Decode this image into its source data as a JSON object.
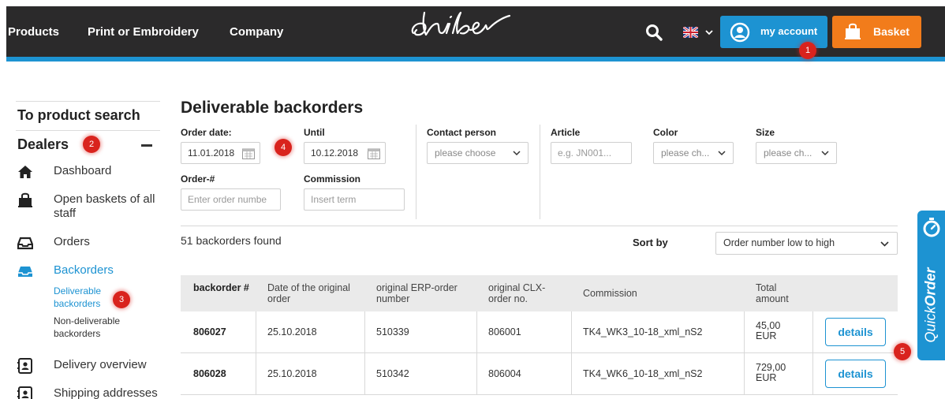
{
  "nav": {
    "links": [
      "Products",
      "Print or Embroidery",
      "Company"
    ],
    "logo_text": "daiber",
    "account_label": "my account",
    "basket_label": "Basket",
    "flag_icon": "uk-flag-icon"
  },
  "markers": [
    "1",
    "2",
    "3",
    "4",
    "5"
  ],
  "sidebar": {
    "product_search": "To product search",
    "section_title": "Dealers",
    "items": [
      {
        "label": "Dashboard",
        "icon": "home-icon"
      },
      {
        "label": "Open baskets of all staff",
        "icon": "basket-icon"
      },
      {
        "label": "Orders",
        "icon": "inbox-icon"
      },
      {
        "label": "Backorders",
        "icon": "inbox-icon"
      },
      {
        "label": "Delivery overview",
        "icon": "contact-card-icon"
      },
      {
        "label": "Shipping addresses",
        "icon": "contact-card-icon"
      }
    ],
    "subitems": [
      {
        "label": "Deliverable backorders",
        "active": true
      },
      {
        "label": "Non-deliverable backorders",
        "active": false
      }
    ]
  },
  "main": {
    "title": "Deliverable backorders",
    "filters": {
      "order_date_label": "Order date:",
      "order_date_value": "11.01.2018",
      "until_label": "Until",
      "until_value": "10.12.2018",
      "order_no_label": "Order-#",
      "order_no_placeholder": "Enter order numbe",
      "commission_label": "Commission",
      "commission_placeholder": "Insert term",
      "contact_label": "Contact person",
      "contact_value": "please choose",
      "article_label": "Article",
      "article_placeholder": "e.g. JN001...",
      "color_label": "Color",
      "color_value": "please ch...",
      "size_label": "Size",
      "size_value": "please ch..."
    },
    "results_count": "51 backorders found",
    "sort_label": "Sort by",
    "sort_value": "Order number low to high"
  },
  "table": {
    "headers": [
      "backorder #",
      "Date of the original order",
      "original ERP-order number",
      "original CLX-order no.",
      "Commission",
      "Total amount"
    ],
    "rows": [
      {
        "backorder": "806027",
        "date": "25.10.2018",
        "erp": "510339",
        "clx": "806001",
        "commission": "TK4_WK3_10-18_xml_nS2",
        "amount": "45,00",
        "currency": "EUR",
        "action": "details"
      },
      {
        "backorder": "806028",
        "date": "25.10.2018",
        "erp": "510342",
        "clx": "806004",
        "commission": "TK4_WK6_10-18_xml_nS2",
        "amount": "729,00",
        "currency": "EUR",
        "action": "details"
      }
    ]
  },
  "quick_order": {
    "prefix": "Quick",
    "suffix": "Order"
  },
  "colors": {
    "brand_blue": "#1d93d2",
    "basket_orange": "#f27c1b",
    "header_dark": "#2b2a2b",
    "marker_red": "#d9231d"
  }
}
